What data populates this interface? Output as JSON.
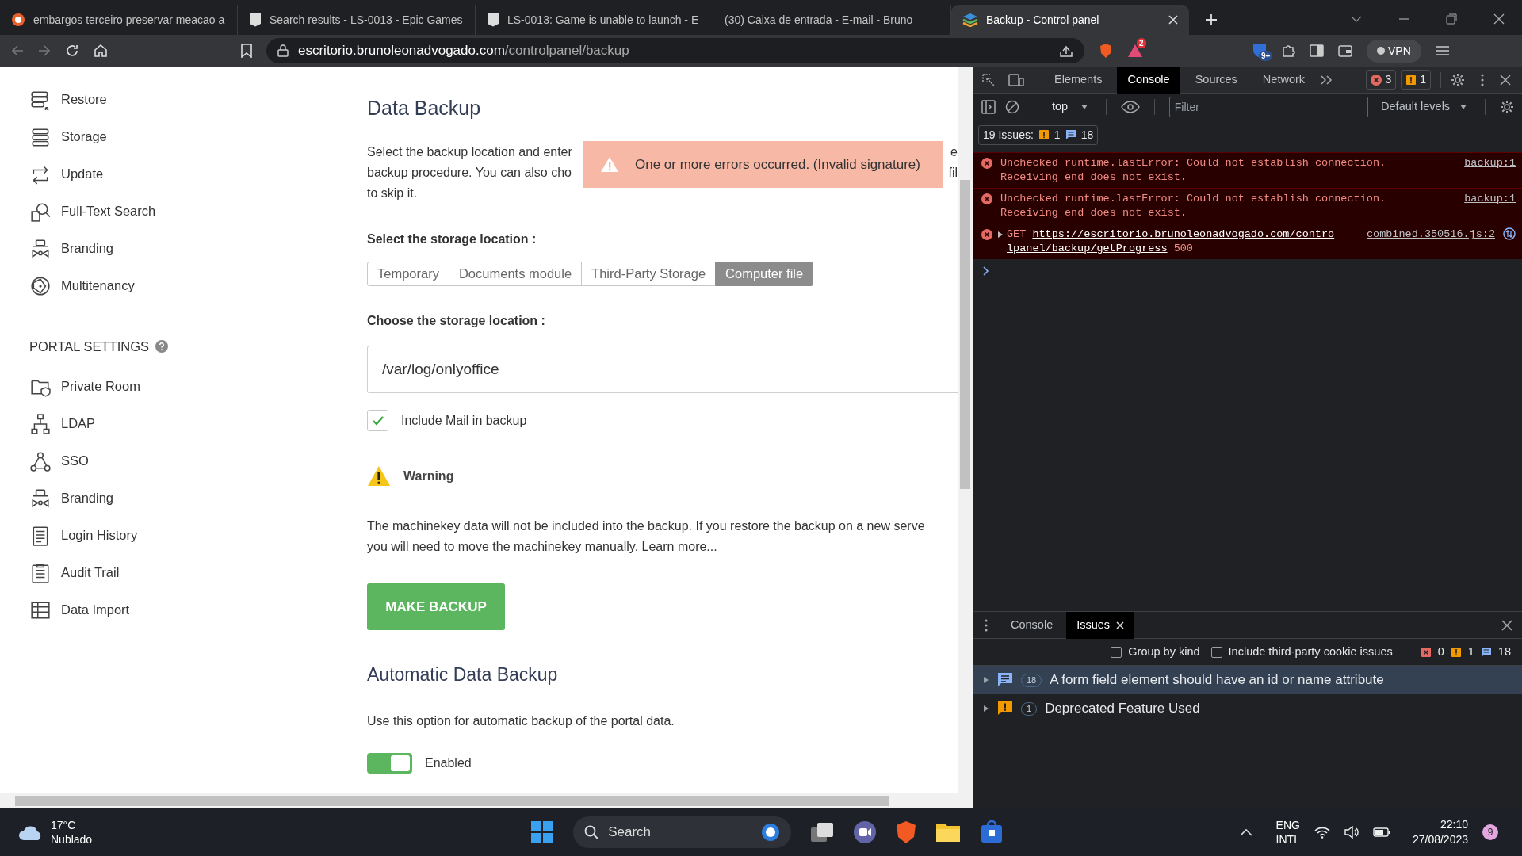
{
  "browser": {
    "tabs": [
      {
        "title": "embargos terceiro preservar meacao a",
        "selected": false
      },
      {
        "title": "Search results - LS-0013 - Epic Games",
        "selected": false
      },
      {
        "title": "LS-0013: Game is unable to launch - E",
        "selected": false
      },
      {
        "title": "(30) Caixa de entrada - E-mail - Bruno",
        "selected": false
      },
      {
        "title": "Backup - Control panel",
        "selected": true
      }
    ],
    "address": {
      "domain": "escritorio.brunoleonadvogado.com",
      "path": "/controlpanel/backup"
    },
    "alerts_badge": "2",
    "extension_badge": "9+",
    "vpn": "VPN"
  },
  "sidebar": {
    "groups": [
      {
        "items": [
          "Restore",
          "Storage",
          "Update",
          "Full-Text Search",
          "Branding",
          "Multitenancy"
        ]
      },
      {
        "heading": "PORTAL SETTINGS",
        "items": [
          "Private Room",
          "LDAP",
          "SSO",
          "Branding",
          "Login History",
          "Audit Trail",
          "Data Import"
        ]
      }
    ]
  },
  "page": {
    "title": "Data Backup",
    "intro_lines": [
      {
        "left": "Select the backup location and enter",
        "right": "e"
      },
      {
        "left": "backup procedure. You can also cho",
        "right": "fil"
      },
      {
        "left": "to skip it."
      }
    ],
    "toast": {
      "message": "One or more errors occurred. (Invalid signature)"
    },
    "storage_label": "Select the storage location :",
    "storage_options": [
      {
        "label": "Temporary",
        "selected": false
      },
      {
        "label": "Documents module",
        "selected": false
      },
      {
        "label": "Third-Party Storage",
        "selected": false
      },
      {
        "label": "Computer file",
        "selected": true
      }
    ],
    "location_label": "Choose the storage location :",
    "location_value": "/var/log/onlyoffice",
    "include_mail": {
      "label": "Include Mail in backup",
      "checked": true
    },
    "warning": {
      "title": "Warning",
      "line_1": "The machinekey data will not be included into the backup. If you restore the backup on a new serve",
      "line_2": "you will need to move the machinekey manually.",
      "link": "Learn more..."
    },
    "make_backup_button": "MAKE BACKUP",
    "auto_title": "Automatic Data Backup",
    "auto_text": "Use this option for automatic backup of the portal data.",
    "auto_toggle": {
      "label": "Enabled",
      "on": true
    }
  },
  "devtools": {
    "tabs": [
      {
        "label": "Elements",
        "selected": false
      },
      {
        "label": "Console",
        "selected": true
      },
      {
        "label": "Sources",
        "selected": false
      },
      {
        "label": "Network",
        "selected": false
      }
    ],
    "error_count": "3",
    "warning_count": "1",
    "context": "top",
    "filter_placeholder": "Filter",
    "levels": "Default levels",
    "issues_summary": {
      "label": "19 Issues:",
      "warnings": "1",
      "info": "18"
    },
    "messages": [
      {
        "kind": "error",
        "text": "Unchecked runtime.lastError: Could not establish connection. Receiving end does not exist.",
        "source": "backup:1"
      },
      {
        "kind": "error",
        "text": "Unchecked runtime.lastError: Could not establish connection. Receiving end does not exist.",
        "source": "backup:1"
      },
      {
        "kind": "network",
        "method": "GET",
        "url": "https://escritorio.brunoleonadvogado.com/controlpanel/backup/getProgress",
        "status": "500",
        "source": "combined.350516.js:2"
      }
    ],
    "drawer": {
      "tabs": [
        {
          "label": "Console",
          "selected": false
        },
        {
          "label": "Issues",
          "selected": true
        }
      ],
      "group_by_kind": {
        "label": "Group by kind",
        "checked": false
      },
      "third_party": {
        "label": "Include third-party cookie issues",
        "checked": false
      },
      "counts": {
        "errors": "0",
        "warnings": "1",
        "info": "18"
      },
      "issues": [
        {
          "kind": "info",
          "count": "18",
          "title": "A form field element should have an id or name attribute",
          "selected": true
        },
        {
          "kind": "warning",
          "count": "1",
          "title": "Deprecated Feature Used",
          "selected": false
        }
      ]
    }
  },
  "taskbar": {
    "weather": {
      "temp": "17°C",
      "condition": "Nublado"
    },
    "search": "Search",
    "language": [
      "ENG",
      "INTL"
    ],
    "time": "22:10",
    "date": "27/08/2023",
    "notifications": "9"
  }
}
